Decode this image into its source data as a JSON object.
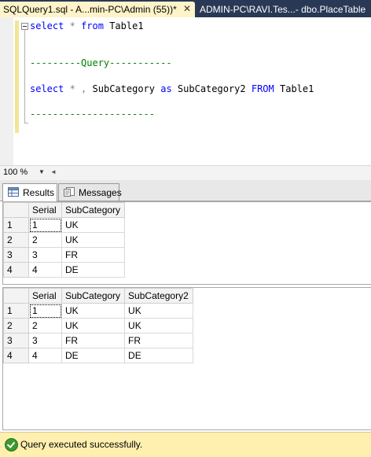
{
  "tabs": {
    "active_label": "SQLQuery1.sql - A...min-PC\\Admin (55))*",
    "close_glyph": "✕",
    "inactive_label": "ADMIN-PC\\RAVI.Tes...- dbo.PlaceTable"
  },
  "editor": {
    "line1": {
      "kw1": "select",
      "op": "*",
      "kw2": "from",
      "rest": "Table1"
    },
    "comment1": "---------Query-----------",
    "line2": {
      "kw1": "select",
      "op": "* ,",
      "col1": "SubCategory",
      "kw2": "as",
      "col2": "SubCategory2",
      "kw3": "FROM",
      "rest": "Table1"
    },
    "comment2": "----------------------"
  },
  "zoom": {
    "value": "100 %"
  },
  "result_tabs": {
    "results_label": "Results",
    "messages_label": "Messages"
  },
  "grid1": {
    "columns": [
      "Serial",
      "SubCategory"
    ],
    "rows": [
      {
        "n": "1",
        "cells": [
          "1",
          "UK"
        ]
      },
      {
        "n": "2",
        "cells": [
          "2",
          "UK"
        ]
      },
      {
        "n": "3",
        "cells": [
          "3",
          "FR"
        ]
      },
      {
        "n": "4",
        "cells": [
          "4",
          "DE"
        ]
      }
    ]
  },
  "grid2": {
    "columns": [
      "Serial",
      "SubCategory",
      "SubCategory2"
    ],
    "rows": [
      {
        "n": "1",
        "cells": [
          "1",
          "UK",
          "UK"
        ]
      },
      {
        "n": "2",
        "cells": [
          "2",
          "UK",
          "UK"
        ]
      },
      {
        "n": "3",
        "cells": [
          "3",
          "FR",
          "FR"
        ]
      },
      {
        "n": "4",
        "cells": [
          "4",
          "DE",
          "DE"
        ]
      }
    ]
  },
  "status": {
    "message": "Query executed successfully.",
    "background": "#fff0b0"
  }
}
